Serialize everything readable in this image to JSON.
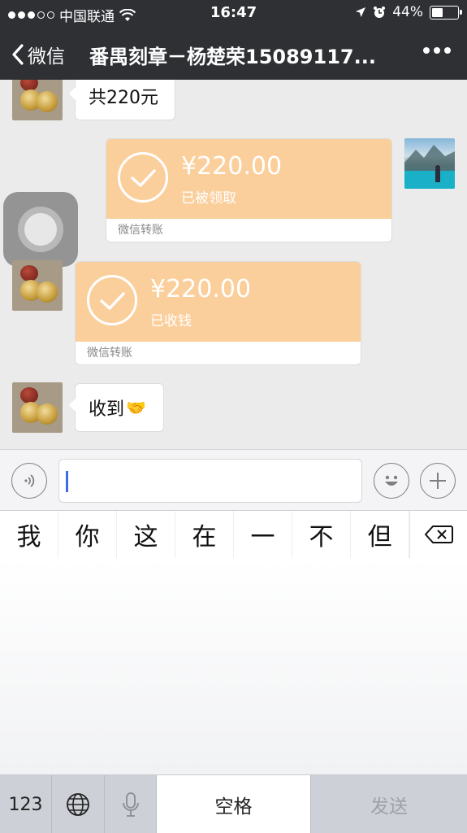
{
  "status_bar": {
    "carrier": "中国联通",
    "time": "16:47",
    "battery": "44%",
    "battery_level": 0.44
  },
  "nav": {
    "back_label": "微信",
    "title": "番禺刻章－杨楚荣15089117...",
    "more_icon": "more-dots-icon"
  },
  "messages": [
    {
      "side": "left",
      "type": "text",
      "text": "共220元"
    },
    {
      "side": "right",
      "type": "transfer",
      "amount": "¥220.00",
      "status": "已被领取",
      "footer": "微信转账"
    },
    {
      "side": "left",
      "type": "transfer",
      "amount": "¥220.00",
      "status": "已收钱",
      "footer": "微信转账"
    },
    {
      "side": "left",
      "type": "text",
      "text": "收到",
      "emoji": "🤝"
    }
  ],
  "colors": {
    "nav_bg": "#2e3034",
    "chat_bg": "#ebebeb",
    "transfer_orange": "#fbcf9c",
    "caret_blue": "#3f6ce6"
  },
  "input_bar": {
    "voice_icon": "voice-icon",
    "emoji_icon": "emoji-icon",
    "plus_icon": "plus-icon",
    "text_value": ""
  },
  "candidates": [
    "我",
    "你",
    "这",
    "在",
    "一",
    "不",
    "但"
  ],
  "keyboard": {
    "numbers_label": "123",
    "globe_icon": "globe-icon",
    "mic_icon": "microphone-icon",
    "space_label": "空格",
    "send_label": "发送",
    "delete_icon": "backspace-icon"
  }
}
